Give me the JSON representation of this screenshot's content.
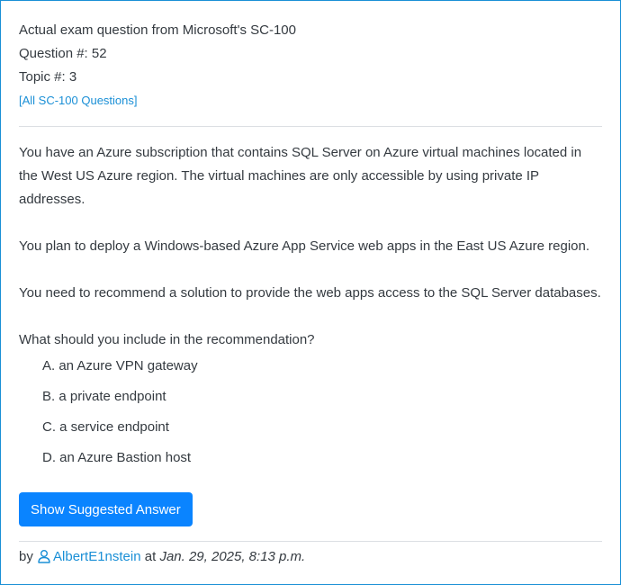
{
  "header": {
    "title": "Actual exam question from Microsoft's SC-100",
    "question_number": "Question #: 52",
    "topic": "Topic #: 3",
    "all_questions_link": "[All SC-100 Questions]"
  },
  "question": {
    "paragraph_1": "You have an Azure subscription that contains SQL Server on Azure virtual machines located in the West US Azure region. The virtual machines are only accessible by using private IP addresses.",
    "paragraph_2": "You plan to deploy a Windows-based Azure App Service web apps in the East US Azure region.",
    "paragraph_3": "You need to recommend a solution to provide the web apps access to the SQL Server databases.",
    "paragraph_4": "What should you include in the recommendation?"
  },
  "choices": [
    {
      "label": "A. an Azure VPN gateway"
    },
    {
      "label": "B. a private endpoint"
    },
    {
      "label": "C. a service endpoint"
    },
    {
      "label": "D. an Azure Bastion host"
    }
  ],
  "answer_button": "Show Suggested Answer",
  "footer": {
    "by": "by",
    "icon": "user-icon",
    "username": "AlbertE1nstein",
    "at": "at",
    "date": "Jan. 29, 2025, 8:13 p.m."
  },
  "colors": {
    "accent": "#1a8fd6",
    "button": "#0a84ff",
    "text": "#343a40"
  }
}
